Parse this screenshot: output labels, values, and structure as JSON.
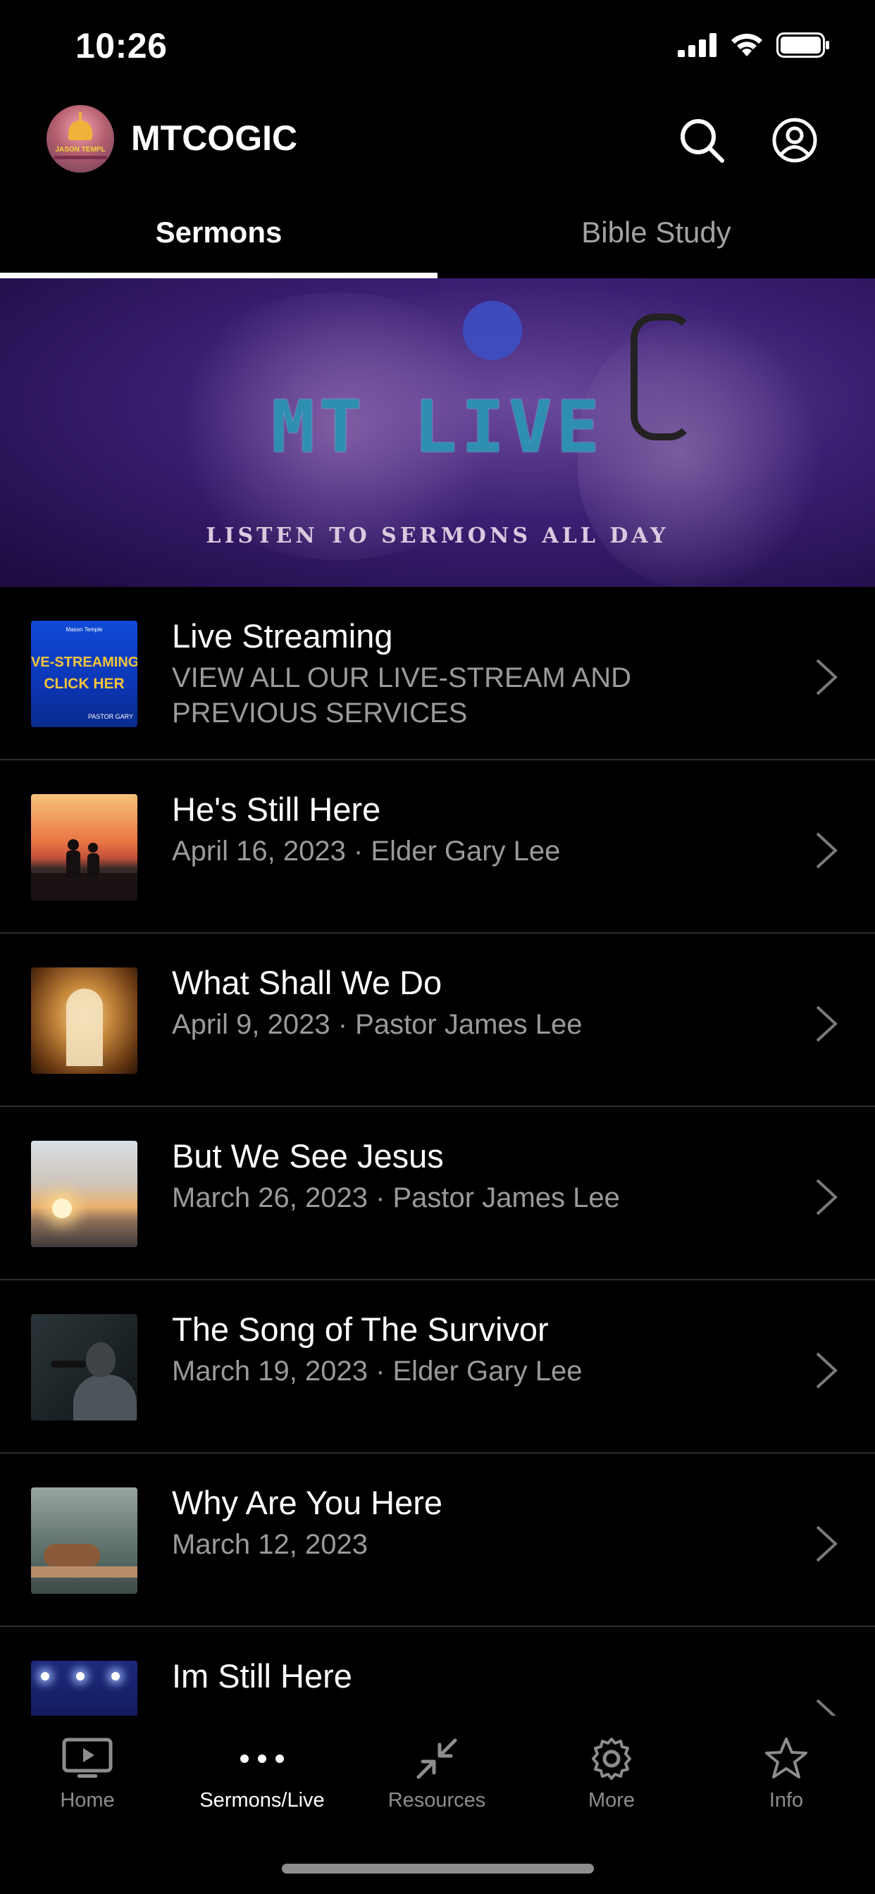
{
  "status_bar": {
    "time": "10:26"
  },
  "header": {
    "brand": "MTCOGIC",
    "avatar_text": "JASON TEMPL"
  },
  "tabs": [
    {
      "label": "Sermons",
      "active": true
    },
    {
      "label": "Bible Study",
      "active": false
    }
  ],
  "banner": {
    "title": "MT LIVE",
    "subtitle": "LISTEN TO SERMONS ALL DAY"
  },
  "list": [
    {
      "title": "Live Streaming",
      "subtitle": "VIEW ALL OUR LIVE-STREAM AND PREVIOUS SERVICES",
      "thumb": {
        "top": "Mason Temple",
        "line1": "VE-STREAMING",
        "line2": "CLICK HER",
        "corner": "PASTOR GARY"
      }
    },
    {
      "title": "He's Still Here",
      "subtitle": "April 16, 2023 · Elder Gary Lee"
    },
    {
      "title": "What Shall We Do",
      "subtitle": "April 9, 2023 · Pastor James Lee"
    },
    {
      "title": "But We See Jesus",
      "subtitle": "March 26, 2023 · Pastor James Lee"
    },
    {
      "title": "The Song of The Survivor",
      "subtitle": "March 19, 2023 · Elder Gary Lee"
    },
    {
      "title": "Why Are You Here",
      "subtitle": "March 12, 2023"
    },
    {
      "title": "Im Still Here",
      "subtitle": ""
    }
  ],
  "bottom_nav": [
    {
      "label": "Home",
      "icon": "tv-play-icon",
      "active": false
    },
    {
      "label": "Sermons/Live",
      "icon": "more-dots-icon",
      "active": true
    },
    {
      "label": "Resources",
      "icon": "compress-arrows-icon",
      "active": false
    },
    {
      "label": "More",
      "icon": "gear-icon",
      "active": false
    },
    {
      "label": "Info",
      "icon": "star-icon",
      "active": false
    }
  ],
  "colors": {
    "background": "#000000",
    "muted_text": "#9a9a9a",
    "banner_title": "#2f8fb0",
    "divider": "#2e2e2e"
  }
}
